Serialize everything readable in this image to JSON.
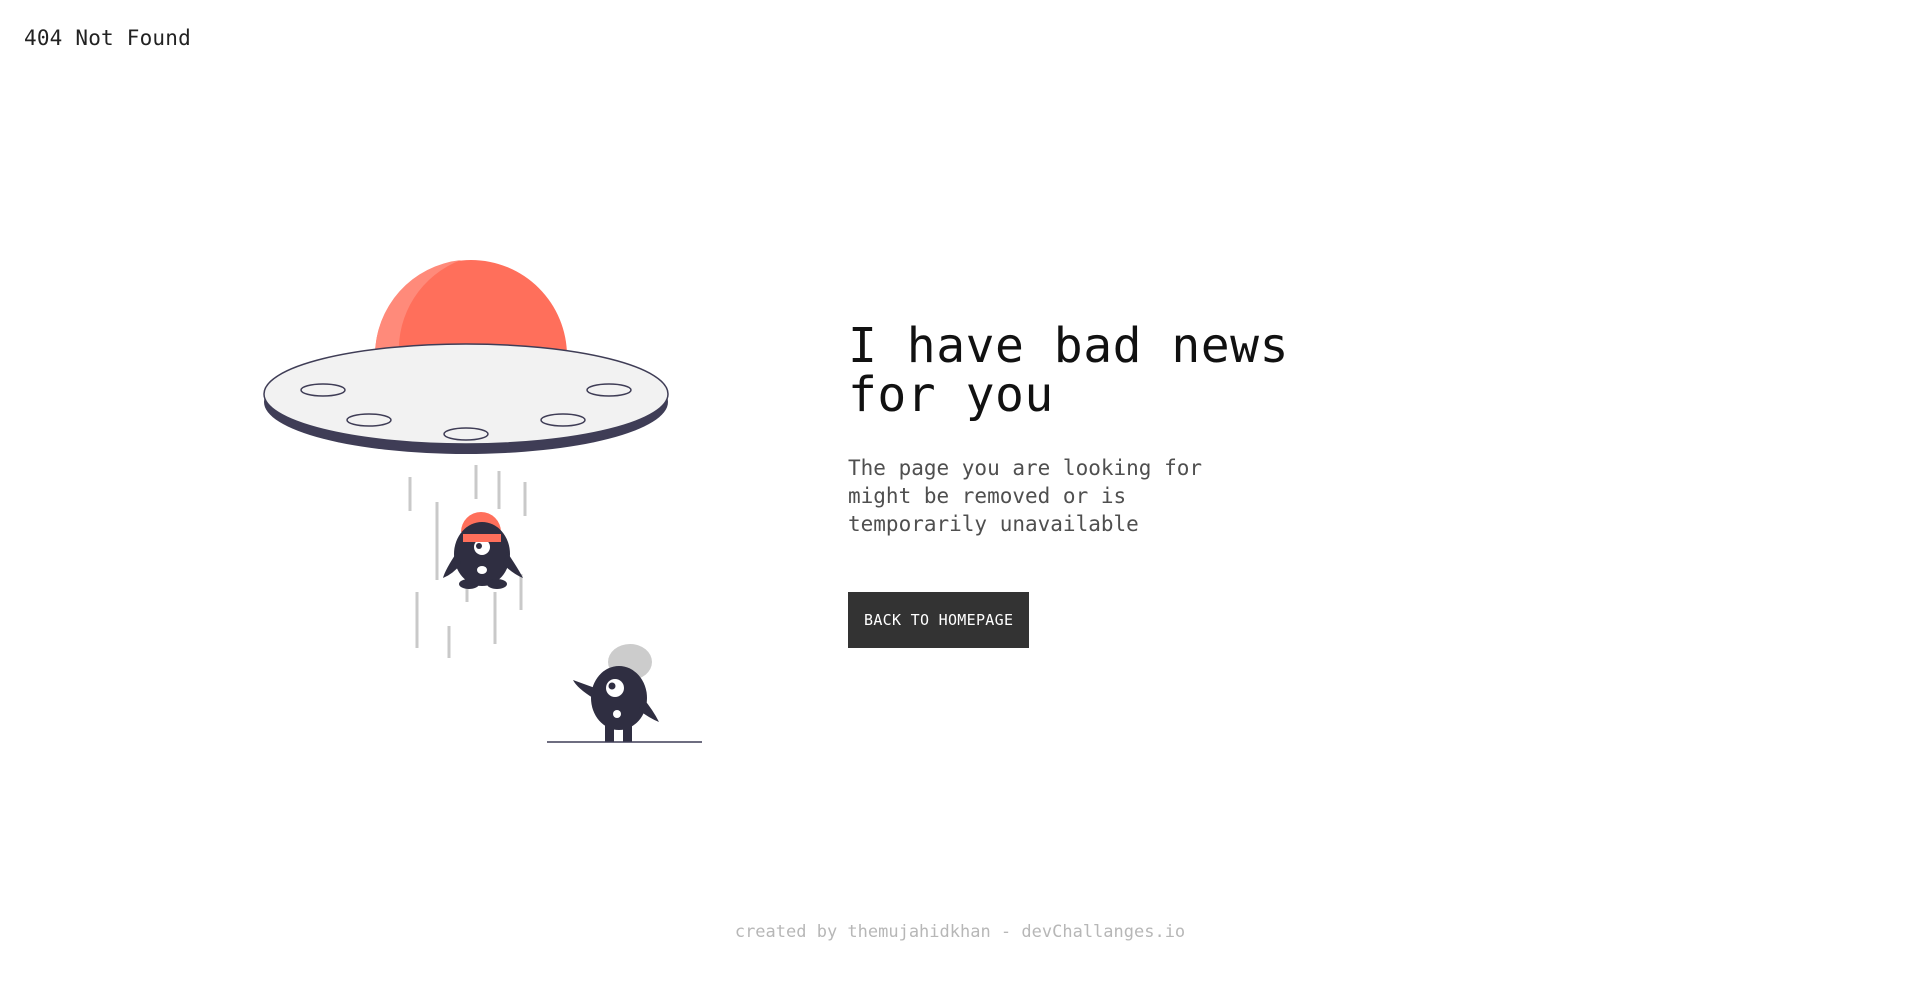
{
  "page": {
    "top_title": "404 Not Found"
  },
  "main": {
    "headline": "I have bad news for you",
    "message": "The page you are looking for might be removed or is temporarily unavailable",
    "button_label": "BACK TO HOMEPAGE"
  },
  "footer": {
    "text": "created by themujahidkhan - devChallanges.io"
  },
  "illustration": {
    "name": "ufo-abduction-illustration",
    "colors": {
      "dome": "#ff6f5b",
      "saucer_body": "#f2f2f2",
      "saucer_rim": "#3f3d56",
      "creature": "#2f2e41",
      "beam_lines": "#c9c9c9",
      "helmet": "#cccccc"
    }
  },
  "colors": {
    "button_bg": "#333333",
    "button_text": "#ffffff",
    "footer_text": "#b7b7b7"
  }
}
